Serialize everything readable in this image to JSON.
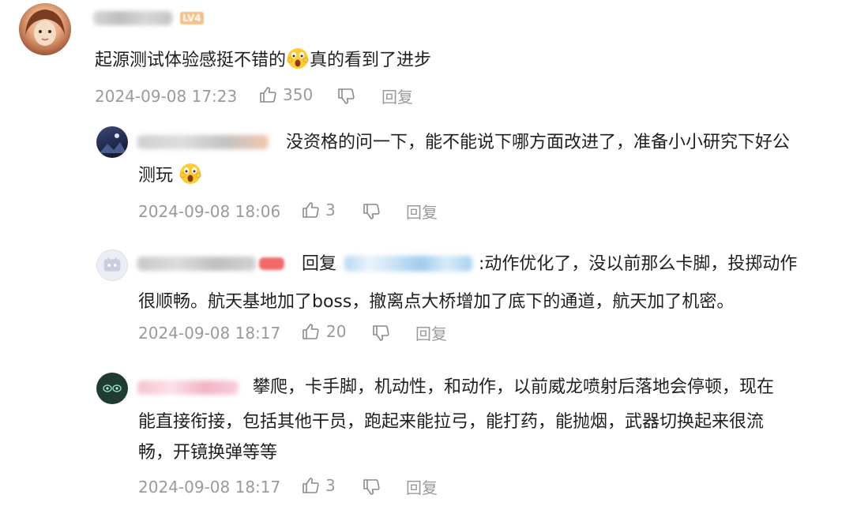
{
  "comments": [
    {
      "badge": "LV4",
      "text": "起源测试体验感挺不错的",
      "emoji": "scream-emoji",
      "text_after": "真的看到了进步",
      "time": "2024-09-08 17:23",
      "likes": "350",
      "reply_label": "回复"
    },
    {
      "line1": "没资格的问一下，能不能说下哪方面改进了，准备小小研究下好公",
      "line2": "测玩",
      "emoji": "scream-emoji",
      "time": "2024-09-08 18:06",
      "likes": "3",
      "reply_label": "回复"
    },
    {
      "reply_prefix": "回复",
      "line1_rest": ":动作优化了，没以前那么卡脚，投掷动作",
      "line2": "很顺畅。航天基地加了boss，撤离点大桥增加了底下的通道，航天加了机密。",
      "time": "2024-09-08 18:17",
      "likes": "20",
      "reply_label": "回复"
    },
    {
      "line1": "攀爬，卡手脚，机动性，和动作，以前威龙喷射后落地会停顿，现在",
      "line2": "能直接衔接，包括其他干员，跑起来能拉弓，能打药，能抛烟，武器切换起来很流",
      "line3": "畅，开镜换弹等等",
      "time": "2024-09-08 18:17",
      "likes": "3",
      "reply_label": "回复"
    }
  ],
  "colors": {
    "meta_text": "#9a9a9a",
    "body_text": "#1f1f1f"
  }
}
